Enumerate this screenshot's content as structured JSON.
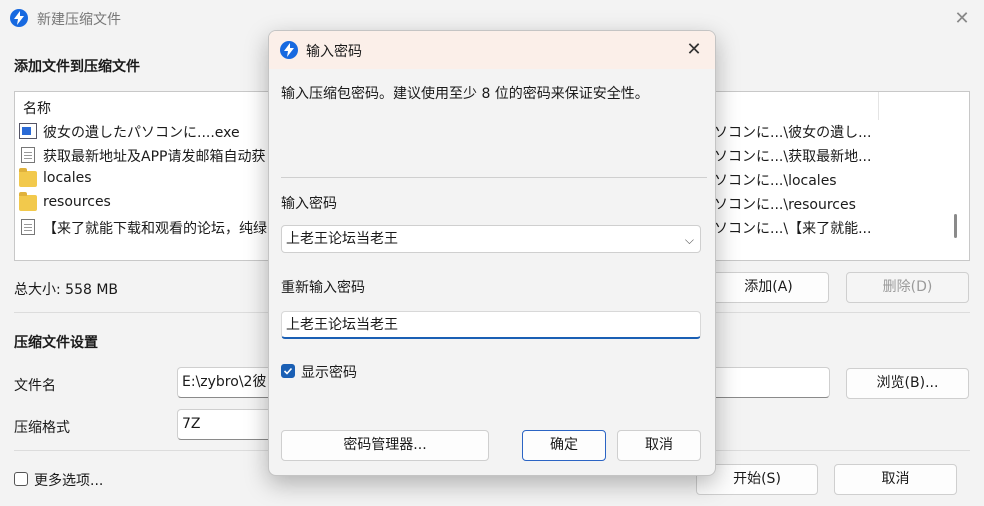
{
  "window": {
    "title": "新建压缩文件",
    "close": "✕"
  },
  "main": {
    "add_section_title": "添加文件到压缩文件",
    "list_header": "名称",
    "files": [
      {
        "name": "彼女の遺したパソコンに....exe",
        "icon": "exe-icon",
        "path": "ソコンに...\\彼女の遺し..."
      },
      {
        "name": "获取最新地址及APP请发邮箱自动获",
        "icon": "document-icon",
        "path": "ソコンに...\\获取最新地..."
      },
      {
        "name": "locales",
        "icon": "folder-icon",
        "path": "ソコンに...\\locales"
      },
      {
        "name": "resources",
        "icon": "folder-icon",
        "path": "ソコンに...\\resources"
      },
      {
        "name": "【来了就能下载和观看的论坛，纯绿",
        "icon": "document-icon",
        "path": "ソコンに...\\【来了就能..."
      }
    ],
    "total_size": "总大小: 558 MB",
    "add_button": "添加(A)",
    "delete_button": "删除(D)",
    "settings_title": "压缩文件设置",
    "filename_label": "文件名",
    "filename_value": "E:\\zybro\\2彼",
    "browse_button": "浏览(B)...",
    "format_label": "压缩格式",
    "format_value": "7Z",
    "more_options": "更多选项...",
    "start_button": "开始(S)",
    "cancel_button": "取消"
  },
  "dialog": {
    "title": "输入密码",
    "close": "✕",
    "description": "输入压缩包密码。建议使用至少 8 位的密码来保证安全性。",
    "password_label": "输入密码",
    "password_value": "上老王论坛当老王",
    "repeat_label": "重新输入密码",
    "repeat_value": "上老王论坛当老王",
    "show_password": "显示密码",
    "show_password_checked": true,
    "manager_button": "密码管理器...",
    "ok_button": "确定",
    "cancel_button": "取消"
  },
  "colors": {
    "accent": "#1a5fb4",
    "dialog_title_bg": "#fbefe9"
  }
}
